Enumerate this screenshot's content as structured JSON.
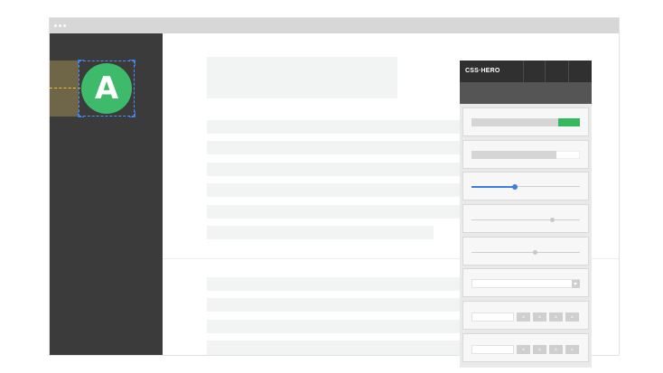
{
  "sidebar": {
    "selected_element": {
      "letter": "A",
      "color": "#3dbb6b"
    }
  },
  "panel": {
    "logo_text": "CSS·HERO",
    "toggle_value": 0.2,
    "bar_value": 0.78,
    "slider_1": 0.4,
    "slider_2": 0.74,
    "slider_3": 0.58,
    "chips_row_1": [
      "A",
      "A",
      "A",
      "A"
    ],
    "chips_row_2": [
      "A",
      "A",
      "A",
      "A"
    ],
    "accent": "#3c7fe0",
    "success": "#35b85e"
  }
}
